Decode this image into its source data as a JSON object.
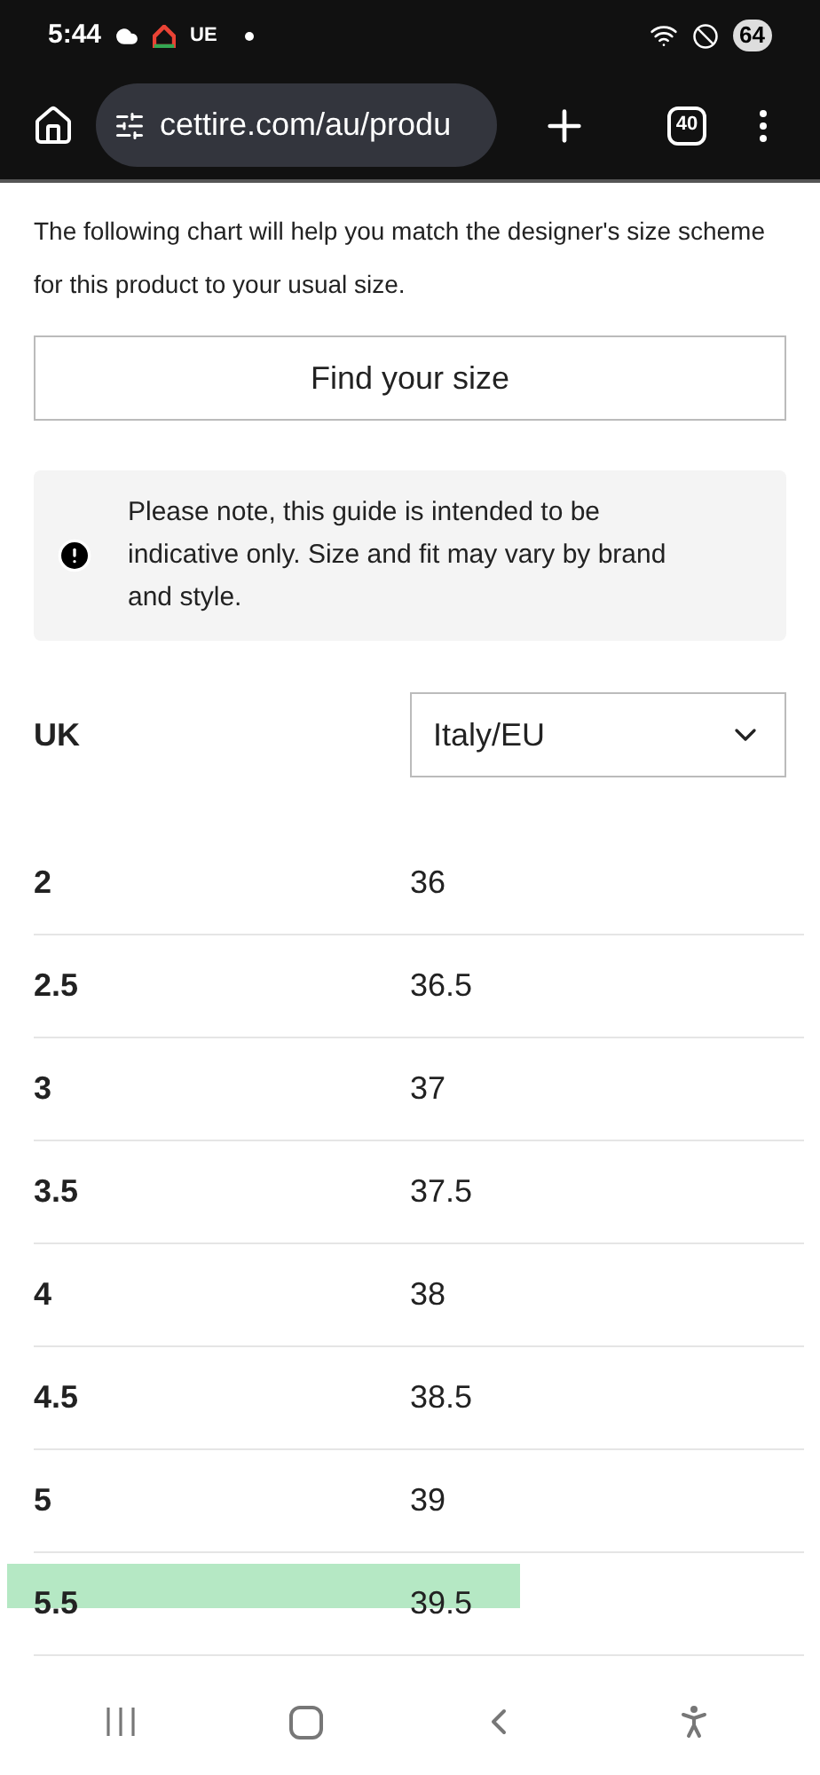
{
  "status_bar": {
    "time": "5:44",
    "carrier": "UE",
    "battery": "64"
  },
  "browser": {
    "url": "cettire.com/au/produ",
    "tab_count": "40"
  },
  "intro": "The following chart will help you match the designer's size scheme for this product to your usual size.",
  "find_button": "Find your size",
  "notice": "Please note, this guide is intended to be indicative only. Size and fit may vary by brand and style.",
  "table": {
    "column_1": "UK",
    "select": {
      "value": "Italy/EU"
    },
    "rows": [
      {
        "uk": "2",
        "eu": "36",
        "highlighted": false
      },
      {
        "uk": "2.5",
        "eu": "36.5",
        "highlighted": false
      },
      {
        "uk": "3",
        "eu": "37",
        "highlighted": false
      },
      {
        "uk": "3.5",
        "eu": "37.5",
        "highlighted": false
      },
      {
        "uk": "4",
        "eu": "38",
        "highlighted": false
      },
      {
        "uk": "4.5",
        "eu": "38.5",
        "highlighted": false
      },
      {
        "uk": "5",
        "eu": "39",
        "highlighted": false
      },
      {
        "uk": "5.5",
        "eu": "39.5",
        "highlighted": true
      }
    ]
  }
}
